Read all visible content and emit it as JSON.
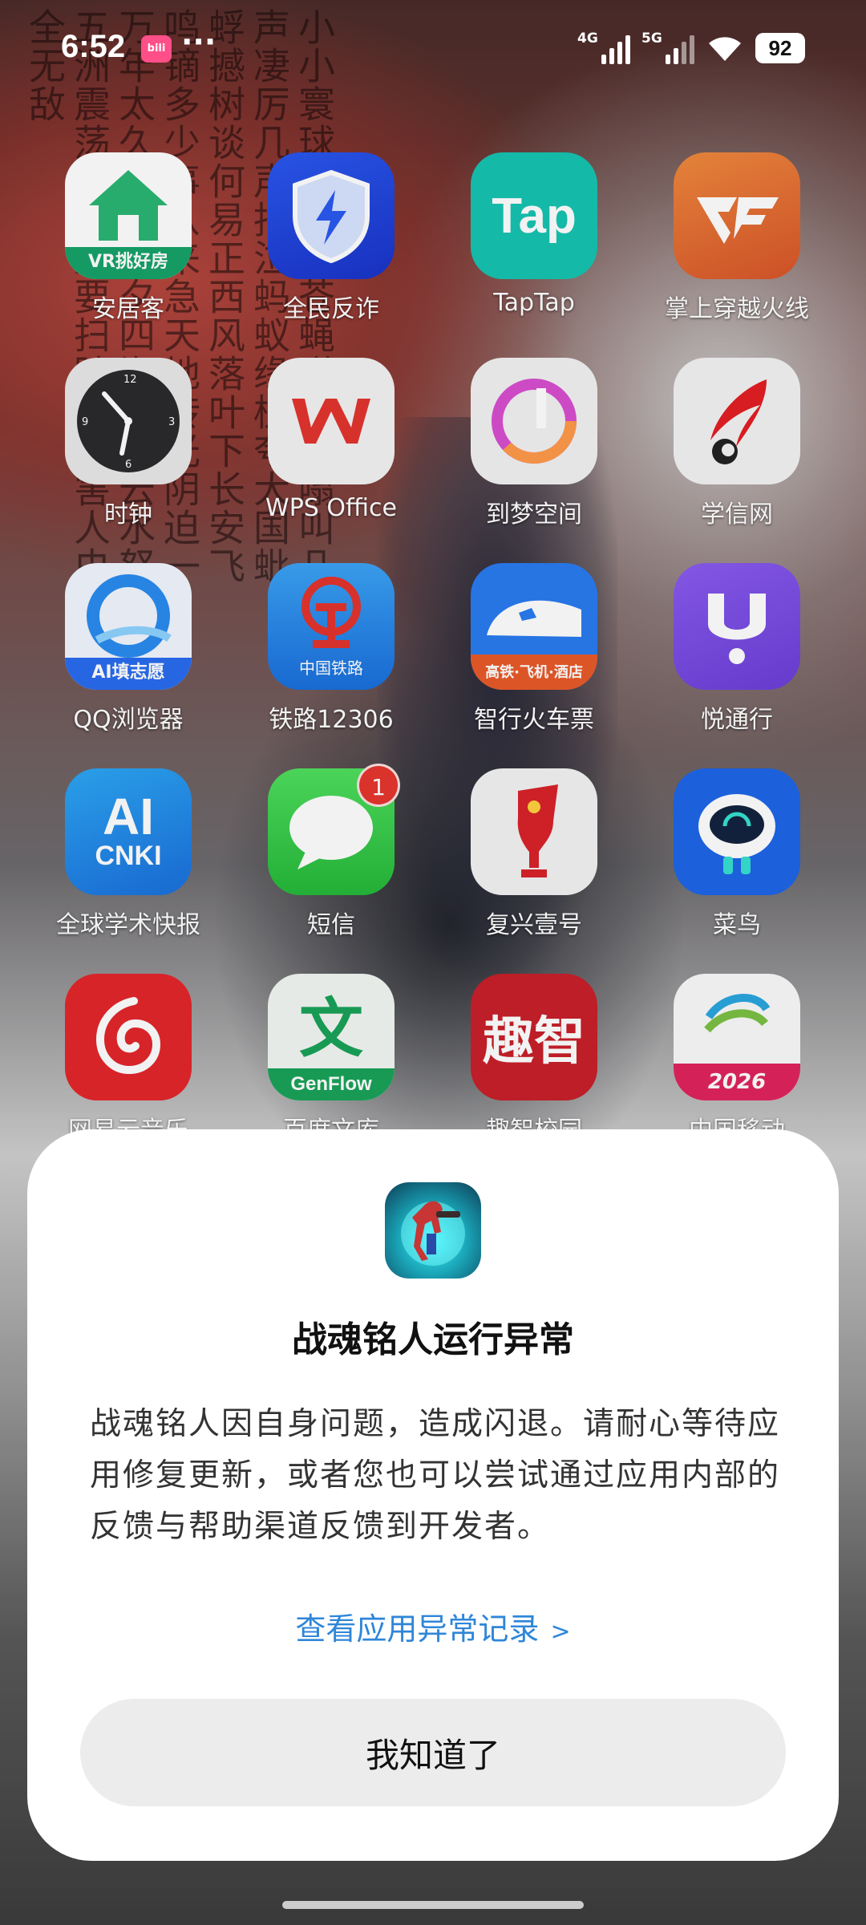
{
  "status_bar": {
    "time": "6:52",
    "app_indicator": "bilibili",
    "more": "···",
    "network1": "4G",
    "network2": "5G",
    "battery": "92"
  },
  "wallpaper": {
    "calligraphy": "小小寰球有几个苍蝇碰壁嗡嗡叫几声凄厉几声抽泣蚂蚁缘槐夸大国蚍蜉撼树谈何易正西风落叶下长安飞鸣镝多少事从来急天地转光阴迫一万年太久只争朝夕四海翻腾云水怒五洲震荡风雷激要扫除一切害人虫全无敌"
  },
  "apps": [
    {
      "label": "安居客",
      "icon": "anjuke-icon",
      "icon_text": "VR挑好房"
    },
    {
      "label": "全民反诈",
      "icon": "anti-fraud-icon",
      "icon_text": ""
    },
    {
      "label": "TapTap",
      "icon": "taptap-icon",
      "icon_text": "Tap"
    },
    {
      "label": "掌上穿越火线",
      "icon": "crossfire-icon",
      "icon_text": ""
    },
    {
      "label": "时钟",
      "icon": "clock-icon",
      "icon_text": ""
    },
    {
      "label": "WPS Office",
      "icon": "wps-icon",
      "icon_text": ""
    },
    {
      "label": "到梦空间",
      "icon": "dream-space-icon",
      "icon_text": ""
    },
    {
      "label": "学信网",
      "icon": "chsi-icon",
      "icon_text": ""
    },
    {
      "label": "QQ浏览器",
      "icon": "qq-browser-icon",
      "icon_text": "AI填志愿"
    },
    {
      "label": "铁路12306",
      "icon": "railway-icon",
      "icon_text": "中国铁路"
    },
    {
      "label": "智行火车票",
      "icon": "zhixing-icon",
      "icon_text": "高铁·飞机·酒店"
    },
    {
      "label": "悦通行",
      "icon": "yuetongxing-icon",
      "icon_text": ""
    },
    {
      "label": "全球学术快报",
      "icon": "cnki-icon",
      "icon_text": "CNKI"
    },
    {
      "label": "短信",
      "icon": "messages-icon",
      "icon_text": "",
      "badge": "1"
    },
    {
      "label": "复兴壹号",
      "icon": "fuxing-icon",
      "icon_text": ""
    },
    {
      "label": "菜鸟",
      "icon": "cainiao-icon",
      "icon_text": ""
    },
    {
      "label": "网易云音乐",
      "icon": "netease-music-icon",
      "icon_text": ""
    },
    {
      "label": "百度文库",
      "icon": "baidu-wenku-icon",
      "icon_text": "GenFlow"
    },
    {
      "label": "趣智校园",
      "icon": "quzhi-icon",
      "icon_text": "趣智"
    },
    {
      "label": "中国移动",
      "icon": "china-mobile-icon",
      "icon_text": "2026"
    }
  ],
  "dialog": {
    "icon": "game-app-icon",
    "title": "战魂铭人运行异常",
    "message": "战魂铭人因自身问题，造成闪退。请耐心等待应用修复更新，或者您也可以尝试通过应用内部的反馈与帮助渠道反馈到开发者。",
    "link": "查看应用异常记录",
    "link_chevron": ">",
    "button": "我知道了"
  },
  "colors": {
    "link": "#2f86d8",
    "button_bg": "#ececec",
    "badge": "#e5362f"
  }
}
